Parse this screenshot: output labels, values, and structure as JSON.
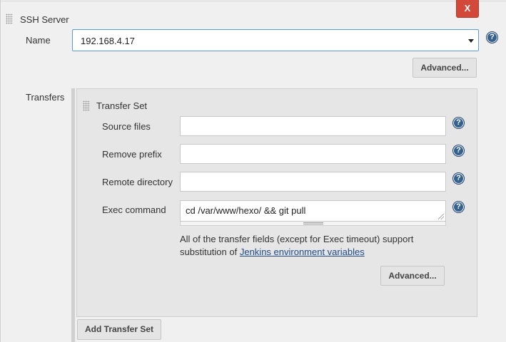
{
  "ssh_server": {
    "section_title": "SSH Server",
    "close_label": "X",
    "name_label": "Name",
    "name_value": "192.168.4.17",
    "advanced_label": "Advanced..."
  },
  "transfers": {
    "label": "Transfers",
    "set_title": "Transfer Set",
    "fields": [
      {
        "label": "Source files",
        "value": ""
      },
      {
        "label": "Remove prefix",
        "value": ""
      },
      {
        "label": "Remote directory",
        "value": ""
      },
      {
        "label": "Exec command",
        "value": "cd /var/www/hexo/ && git pull"
      }
    ],
    "description": "All of the transfer fields (except for Exec timeout) support substitution of",
    "link_text": "Jenkins environment variables",
    "advanced_label": "Advanced...",
    "add_label": "Add Transfer Set"
  },
  "help_glyph": "?",
  "colors": {
    "close_button": "#d24939",
    "help_icon": "#36618f",
    "select_focus": "#5b9bd5",
    "link": "#204a87"
  }
}
